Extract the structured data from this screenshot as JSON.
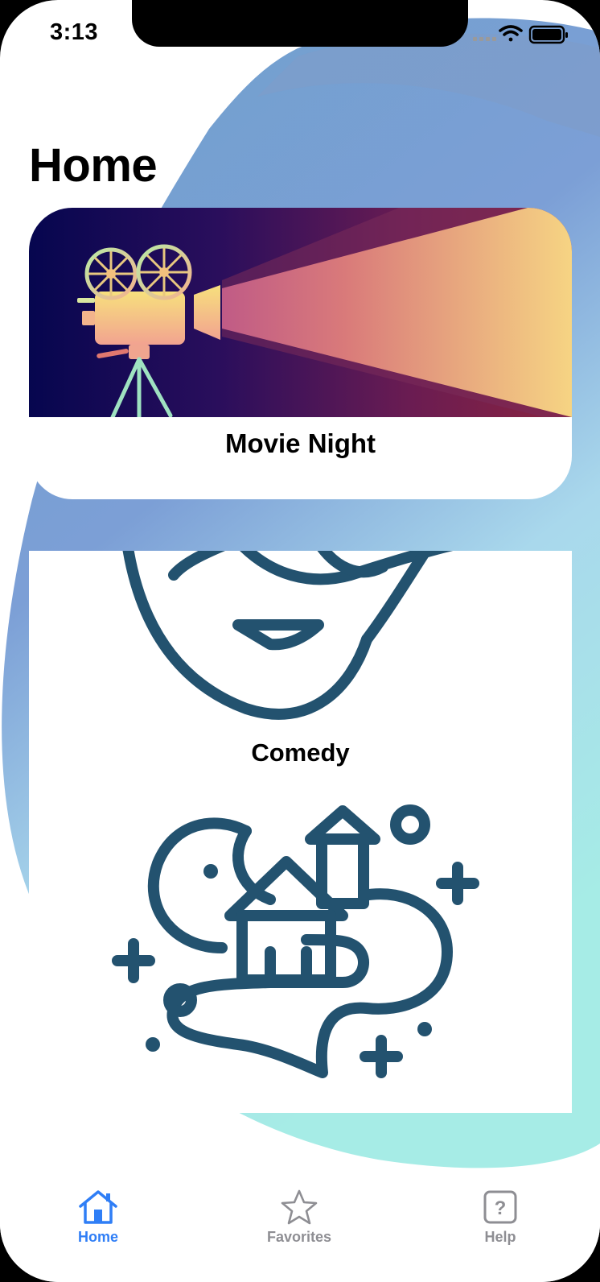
{
  "status_bar": {
    "time": "3:13"
  },
  "page": {
    "title": "Home"
  },
  "cards": [
    {
      "label": "Movie Night",
      "icon": "film-projector-icon"
    },
    {
      "label": "Comedy",
      "icon": "comedy-mask-icon"
    },
    {
      "label": "",
      "icon": "fantasy-castle-icon"
    }
  ],
  "tabbar": {
    "items": [
      {
        "label": "Home",
        "icon": "house-icon",
        "active": true
      },
      {
        "label": "Favorites",
        "icon": "star-icon",
        "active": false
      },
      {
        "label": "Help",
        "icon": "question-icon",
        "active": false
      }
    ]
  },
  "colors": {
    "accent": "#2f7ef6",
    "inactive": "#8e8e93",
    "icon_navy": "#23526f",
    "blob_blue": "#7ea0d6",
    "blob_teal": "#a8e6e2"
  }
}
